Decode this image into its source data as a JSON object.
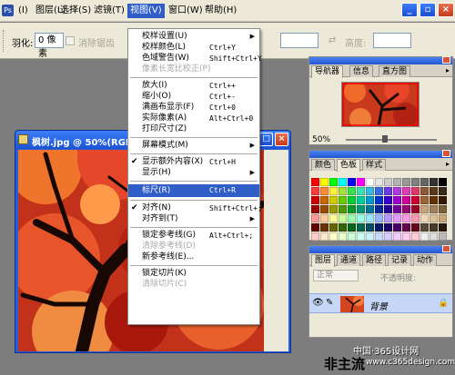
{
  "app_icon_text": "Ps",
  "menubar": {
    "items": [
      {
        "label": "(I)"
      },
      {
        "label": "图层(L)"
      },
      {
        "label": "选择(S)"
      },
      {
        "label": "滤镜(T)"
      },
      {
        "label": "视图(V)"
      },
      {
        "label": "窗口(W)"
      },
      {
        "label": "帮助(H)"
      }
    ]
  },
  "window_controls": {
    "minimize": "_",
    "restore": "▫",
    "close": "×"
  },
  "options_bar": {
    "feather_label": "羽化:",
    "feather_value": "0 像素",
    "antialias_label": "消除锯齿",
    "height_label": "高度:",
    "swap_icon": "⇄"
  },
  "view_menu": {
    "items": [
      {
        "label": "校样设置(U)",
        "shortcut": "",
        "submenu": true,
        "disabled": false
      },
      {
        "label": "校样颜色(L)",
        "shortcut": "Ctrl+Y",
        "submenu": false,
        "disabled": false
      },
      {
        "label": "色域警告(W)",
        "shortcut": "Shift+Ctrl+Y",
        "submenu": false,
        "disabled": false
      },
      {
        "label": "像素长宽比校正(P)",
        "shortcut": "",
        "submenu": false,
        "disabled": true
      },
      {
        "label": "放大(I)",
        "shortcut": "Ctrl++",
        "submenu": false,
        "disabled": false
      },
      {
        "label": "缩小(O)",
        "shortcut": "Ctrl+-",
        "submenu": false,
        "disabled": false
      },
      {
        "label": "满画布显示(F)",
        "shortcut": "Ctrl+0",
        "submenu": false,
        "disabled": false
      },
      {
        "label": "实际像素(A)",
        "shortcut": "Alt+Ctrl+0",
        "submenu": false,
        "disabled": false
      },
      {
        "label": "打印尺寸(Z)",
        "shortcut": "",
        "submenu": false,
        "disabled": false
      },
      {
        "label": "屏幕模式(M)",
        "shortcut": "",
        "submenu": true,
        "disabled": false
      },
      {
        "label": "显示额外内容(X)",
        "shortcut": "Ctrl+H",
        "submenu": false,
        "disabled": false,
        "checked": true
      },
      {
        "label": "显示(H)",
        "shortcut": "",
        "submenu": true,
        "disabled": false
      },
      {
        "label": "标尺(R)",
        "shortcut": "Ctrl+R",
        "submenu": false,
        "disabled": false,
        "highlighted": true
      },
      {
        "label": "对齐(N)",
        "shortcut": "Shift+Ctrl+;",
        "submenu": false,
        "disabled": false,
        "checked": true
      },
      {
        "label": "对齐到(T)",
        "shortcut": "",
        "submenu": true,
        "disabled": false
      },
      {
        "label": "锁定参考线(G)",
        "shortcut": "Alt+Ctrl+;",
        "submenu": false,
        "disabled": false
      },
      {
        "label": "清除参考线(D)",
        "shortcut": "",
        "submenu": false,
        "disabled": true
      },
      {
        "label": "新参考线(E)...",
        "shortcut": "",
        "submenu": false,
        "disabled": false
      },
      {
        "label": "锁定切片(K)",
        "shortcut": "",
        "submenu": false,
        "disabled": false
      },
      {
        "label": "清除切片(C)",
        "shortcut": "",
        "submenu": false,
        "disabled": true
      }
    ]
  },
  "document": {
    "title": "枫树.jpg @ 50%(RGB"
  },
  "navigator_panel": {
    "tabs": [
      "导航器",
      "信息",
      "直方图"
    ],
    "zoom": "50%"
  },
  "color_panel": {
    "tabs": [
      "颜色",
      "色板",
      "样式"
    ],
    "swatches": [
      "#ff0000",
      "#ffff00",
      "#00ff00",
      "#00ffff",
      "#0000ff",
      "#ff00ff",
      "#ffffff",
      "#e6e6e6",
      "#cccccc",
      "#b3b3b3",
      "#999999",
      "#808080",
      "#666666",
      "#333333",
      "#000000",
      "#ff3a3a",
      "#ff8c3a",
      "#fff03a",
      "#a8e03a",
      "#3ae04f",
      "#3ae0b0",
      "#3ab8e0",
      "#3a6be0",
      "#6b3ae0",
      "#b03ae0",
      "#e03ab8",
      "#e03a6b",
      "#8c5a3a",
      "#5a3a1a",
      "#3a2a1a",
      "#cc0000",
      "#cc6600",
      "#cccc00",
      "#66cc00",
      "#00cc33",
      "#00cc99",
      "#0099cc",
      "#0033cc",
      "#3300cc",
      "#9900cc",
      "#cc0099",
      "#cc0033",
      "#996633",
      "#663300",
      "#331a00",
      "#990000",
      "#994c00",
      "#999900",
      "#4c9900",
      "#009926",
      "#009973",
      "#007399",
      "#002699",
      "#260099",
      "#730099",
      "#990073",
      "#990026",
      "#c6a47a",
      "#a0805a",
      "#7a603a",
      "#ff9999",
      "#ffcc99",
      "#ffff99",
      "#ccff99",
      "#99ffb3",
      "#99ffe6",
      "#99e6ff",
      "#99b3ff",
      "#b399ff",
      "#e699ff",
      "#ff99e6",
      "#ff99b3",
      "#f0d8b8",
      "#dcc098",
      "#c8a878",
      "#660000",
      "#663300",
      "#666600",
      "#336600",
      "#00661a",
      "#00664d",
      "#004d66",
      "#001a66",
      "#1a0066",
      "#4d0066",
      "#66004d",
      "#66001a",
      "#5a4a3a",
      "#4a3a2a",
      "#2a1a0a",
      "#ffcccc",
      "#ffe6cc",
      "#ffffcc",
      "#e6ffcc",
      "#ccffd9",
      "#ccfff2",
      "#ccf2ff",
      "#ccd9ff",
      "#d9ccff",
      "#f2ccff",
      "#ffccf2",
      "#ffccd9",
      "#eeeeee",
      "#dddddd",
      "#bbbbbb"
    ]
  },
  "layers_panel": {
    "tabs": [
      "图层",
      "通道",
      "路径",
      "记录",
      "动作"
    ],
    "blend_mode": "正常",
    "opacity_label": "不透明度:",
    "layer_name": "背景",
    "lock_icon": "🔒"
  },
  "watermark": {
    "site_cn": "中国·365设计网",
    "big": "非主流",
    "url": "www.c365design.com"
  }
}
